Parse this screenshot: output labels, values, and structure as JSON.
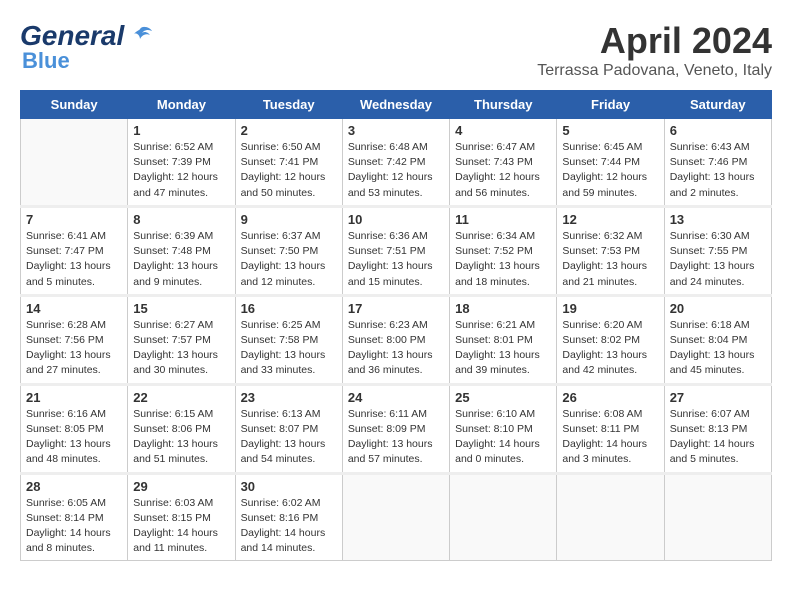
{
  "header": {
    "logo_general": "General",
    "logo_blue": "Blue",
    "title": "April 2024",
    "location": "Terrassa Padovana, Veneto, Italy"
  },
  "days_of_week": [
    "Sunday",
    "Monday",
    "Tuesday",
    "Wednesday",
    "Thursday",
    "Friday",
    "Saturday"
  ],
  "weeks": [
    [
      {
        "day": "",
        "info": ""
      },
      {
        "day": "1",
        "info": "Sunrise: 6:52 AM\nSunset: 7:39 PM\nDaylight: 12 hours\nand 47 minutes."
      },
      {
        "day": "2",
        "info": "Sunrise: 6:50 AM\nSunset: 7:41 PM\nDaylight: 12 hours\nand 50 minutes."
      },
      {
        "day": "3",
        "info": "Sunrise: 6:48 AM\nSunset: 7:42 PM\nDaylight: 12 hours\nand 53 minutes."
      },
      {
        "day": "4",
        "info": "Sunrise: 6:47 AM\nSunset: 7:43 PM\nDaylight: 12 hours\nand 56 minutes."
      },
      {
        "day": "5",
        "info": "Sunrise: 6:45 AM\nSunset: 7:44 PM\nDaylight: 12 hours\nand 59 minutes."
      },
      {
        "day": "6",
        "info": "Sunrise: 6:43 AM\nSunset: 7:46 PM\nDaylight: 13 hours\nand 2 minutes."
      }
    ],
    [
      {
        "day": "7",
        "info": "Sunrise: 6:41 AM\nSunset: 7:47 PM\nDaylight: 13 hours\nand 5 minutes."
      },
      {
        "day": "8",
        "info": "Sunrise: 6:39 AM\nSunset: 7:48 PM\nDaylight: 13 hours\nand 9 minutes."
      },
      {
        "day": "9",
        "info": "Sunrise: 6:37 AM\nSunset: 7:50 PM\nDaylight: 13 hours\nand 12 minutes."
      },
      {
        "day": "10",
        "info": "Sunrise: 6:36 AM\nSunset: 7:51 PM\nDaylight: 13 hours\nand 15 minutes."
      },
      {
        "day": "11",
        "info": "Sunrise: 6:34 AM\nSunset: 7:52 PM\nDaylight: 13 hours\nand 18 minutes."
      },
      {
        "day": "12",
        "info": "Sunrise: 6:32 AM\nSunset: 7:53 PM\nDaylight: 13 hours\nand 21 minutes."
      },
      {
        "day": "13",
        "info": "Sunrise: 6:30 AM\nSunset: 7:55 PM\nDaylight: 13 hours\nand 24 minutes."
      }
    ],
    [
      {
        "day": "14",
        "info": "Sunrise: 6:28 AM\nSunset: 7:56 PM\nDaylight: 13 hours\nand 27 minutes."
      },
      {
        "day": "15",
        "info": "Sunrise: 6:27 AM\nSunset: 7:57 PM\nDaylight: 13 hours\nand 30 minutes."
      },
      {
        "day": "16",
        "info": "Sunrise: 6:25 AM\nSunset: 7:58 PM\nDaylight: 13 hours\nand 33 minutes."
      },
      {
        "day": "17",
        "info": "Sunrise: 6:23 AM\nSunset: 8:00 PM\nDaylight: 13 hours\nand 36 minutes."
      },
      {
        "day": "18",
        "info": "Sunrise: 6:21 AM\nSunset: 8:01 PM\nDaylight: 13 hours\nand 39 minutes."
      },
      {
        "day": "19",
        "info": "Sunrise: 6:20 AM\nSunset: 8:02 PM\nDaylight: 13 hours\nand 42 minutes."
      },
      {
        "day": "20",
        "info": "Sunrise: 6:18 AM\nSunset: 8:04 PM\nDaylight: 13 hours\nand 45 minutes."
      }
    ],
    [
      {
        "day": "21",
        "info": "Sunrise: 6:16 AM\nSunset: 8:05 PM\nDaylight: 13 hours\nand 48 minutes."
      },
      {
        "day": "22",
        "info": "Sunrise: 6:15 AM\nSunset: 8:06 PM\nDaylight: 13 hours\nand 51 minutes."
      },
      {
        "day": "23",
        "info": "Sunrise: 6:13 AM\nSunset: 8:07 PM\nDaylight: 13 hours\nand 54 minutes."
      },
      {
        "day": "24",
        "info": "Sunrise: 6:11 AM\nSunset: 8:09 PM\nDaylight: 13 hours\nand 57 minutes."
      },
      {
        "day": "25",
        "info": "Sunrise: 6:10 AM\nSunset: 8:10 PM\nDaylight: 14 hours\nand 0 minutes."
      },
      {
        "day": "26",
        "info": "Sunrise: 6:08 AM\nSunset: 8:11 PM\nDaylight: 14 hours\nand 3 minutes."
      },
      {
        "day": "27",
        "info": "Sunrise: 6:07 AM\nSunset: 8:13 PM\nDaylight: 14 hours\nand 5 minutes."
      }
    ],
    [
      {
        "day": "28",
        "info": "Sunrise: 6:05 AM\nSunset: 8:14 PM\nDaylight: 14 hours\nand 8 minutes."
      },
      {
        "day": "29",
        "info": "Sunrise: 6:03 AM\nSunset: 8:15 PM\nDaylight: 14 hours\nand 11 minutes."
      },
      {
        "day": "30",
        "info": "Sunrise: 6:02 AM\nSunset: 8:16 PM\nDaylight: 14 hours\nand 14 minutes."
      },
      {
        "day": "",
        "info": ""
      },
      {
        "day": "",
        "info": ""
      },
      {
        "day": "",
        "info": ""
      },
      {
        "day": "",
        "info": ""
      }
    ]
  ]
}
